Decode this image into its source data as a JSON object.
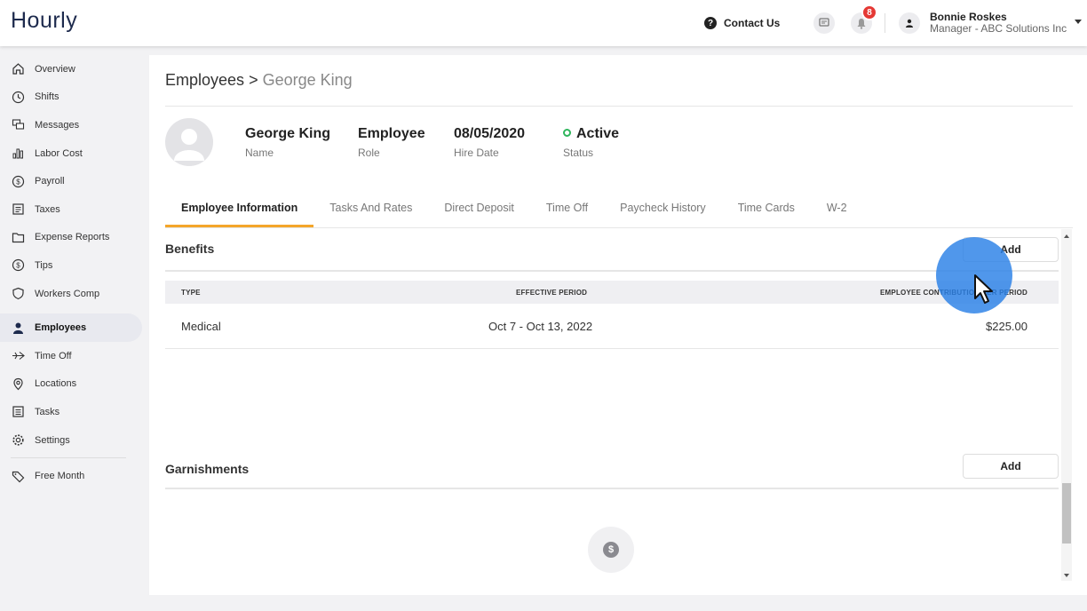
{
  "app": {
    "logo": "Hourly"
  },
  "topbar": {
    "contact_label": "Contact Us",
    "notification_count": "8",
    "user_name": "Bonnie Roskes",
    "user_role": "Manager - ABC Solutions Inc"
  },
  "sidebar": {
    "items": [
      {
        "label": "Overview",
        "icon": "home-icon"
      },
      {
        "label": "Shifts",
        "icon": "clock-icon"
      },
      {
        "label": "Messages",
        "icon": "messages-icon"
      },
      {
        "label": "Labor Cost",
        "icon": "bar-chart-icon"
      },
      {
        "label": "Payroll",
        "icon": "dollar-circle-icon"
      },
      {
        "label": "Taxes",
        "icon": "document-icon"
      },
      {
        "label": "Expense Reports",
        "icon": "folder-icon"
      },
      {
        "label": "Tips",
        "icon": "dollar-circle-icon"
      },
      {
        "label": "Workers Comp",
        "icon": "shield-icon"
      },
      {
        "label": "Employees",
        "icon": "person-icon",
        "active": true
      },
      {
        "label": "Time Off",
        "icon": "plane-icon"
      },
      {
        "label": "Locations",
        "icon": "pin-icon"
      },
      {
        "label": "Tasks",
        "icon": "list-icon"
      },
      {
        "label": "Settings",
        "icon": "gear-icon"
      }
    ],
    "extra": {
      "label": "Free Month",
      "icon": "tag-icon"
    }
  },
  "breadcrumb": {
    "parent": "Employees",
    "separator": ">",
    "current": "George King"
  },
  "employee": {
    "name": "George King",
    "name_label": "Name",
    "role": "Employee",
    "role_label": "Role",
    "hire_date": "08/05/2020",
    "hire_date_label": "Hire Date",
    "status": "Active",
    "status_label": "Status"
  },
  "tabs": [
    {
      "label": "Employee Information",
      "active": true
    },
    {
      "label": "Tasks And Rates"
    },
    {
      "label": "Direct Deposit"
    },
    {
      "label": "Time Off"
    },
    {
      "label": "Paycheck History"
    },
    {
      "label": "Time Cards"
    },
    {
      "label": "W-2"
    }
  ],
  "benefits": {
    "title": "Benefits",
    "add_label": "Add",
    "columns": [
      "TYPE",
      "EFFECTIVE PERIOD",
      "EMPLOYEE CONTRIBUTION PER PERIOD"
    ],
    "rows": [
      {
        "type": "Medical",
        "period": "Oct 7 - Oct 13, 2022",
        "contribution": "$225.00"
      }
    ]
  },
  "garnishments": {
    "title": "Garnishments",
    "add_label": "Add"
  },
  "colors": {
    "accent": "#f4a62a",
    "active_status": "#2fb55c",
    "badge": "#e53935",
    "cursor_halo": "#2980e6"
  }
}
